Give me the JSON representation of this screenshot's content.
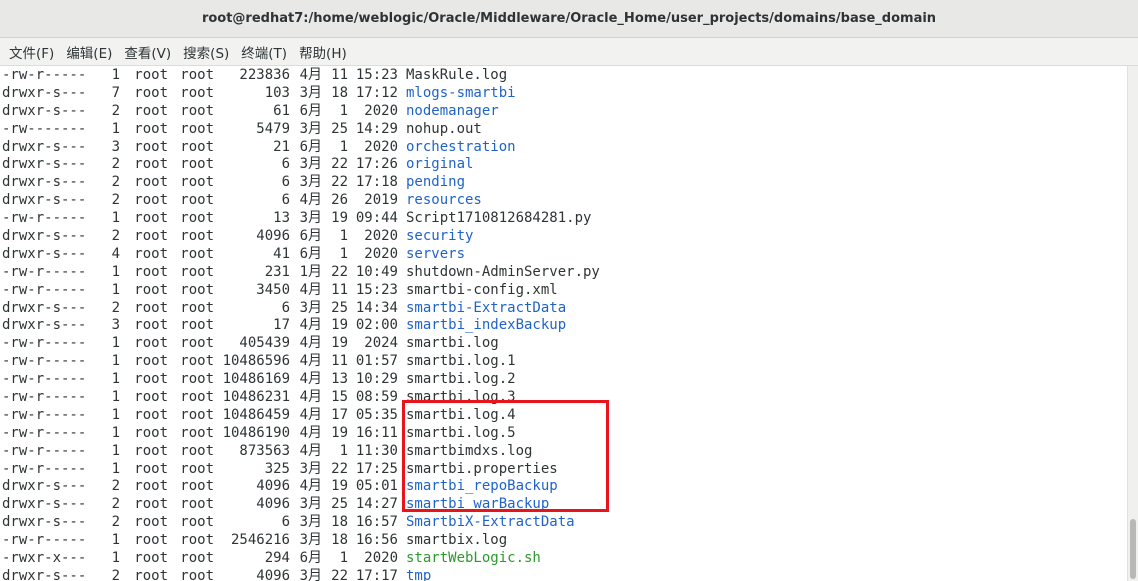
{
  "window": {
    "title": "root@redhat7:/home/weblogic/Oracle/Middleware/Oracle_Home/user_projects/domains/base_domain"
  },
  "menu": [
    "文件(F)",
    "编辑(E)",
    "查看(V)",
    "搜索(S)",
    "终端(T)",
    "帮助(H)"
  ],
  "colors": {
    "directory": "#1f63c8",
    "executable": "#2a9a2a",
    "file": "#2e3436",
    "highlight": "#e8131b"
  },
  "listing": [
    {
      "perm": "-rw-r-----",
      "links": "1",
      "owner": "root",
      "group": "root",
      "size": "223836",
      "month": "4月",
      "day": "11",
      "time": "15:23",
      "name": "MaskRule.log",
      "type": "file"
    },
    {
      "perm": "drwxr-s---",
      "links": "7",
      "owner": "root",
      "group": "root",
      "size": "103",
      "month": "3月",
      "day": "18",
      "time": "17:12",
      "name": "mlogs-smartbi",
      "type": "dir"
    },
    {
      "perm": "drwxr-s---",
      "links": "2",
      "owner": "root",
      "group": "root",
      "size": "61",
      "month": "6月",
      "day": "1",
      "time": "2020",
      "name": "nodemanager",
      "type": "dir"
    },
    {
      "perm": "-rw-------",
      "links": "1",
      "owner": "root",
      "group": "root",
      "size": "5479",
      "month": "3月",
      "day": "25",
      "time": "14:29",
      "name": "nohup.out",
      "type": "file"
    },
    {
      "perm": "drwxr-s---",
      "links": "3",
      "owner": "root",
      "group": "root",
      "size": "21",
      "month": "6月",
      "day": "1",
      "time": "2020",
      "name": "orchestration",
      "type": "dir"
    },
    {
      "perm": "drwxr-s---",
      "links": "2",
      "owner": "root",
      "group": "root",
      "size": "6",
      "month": "3月",
      "day": "22",
      "time": "17:26",
      "name": "original",
      "type": "dir"
    },
    {
      "perm": "drwxr-s---",
      "links": "2",
      "owner": "root",
      "group": "root",
      "size": "6",
      "month": "3月",
      "day": "22",
      "time": "17:18",
      "name": "pending",
      "type": "dir"
    },
    {
      "perm": "drwxr-s---",
      "links": "2",
      "owner": "root",
      "group": "root",
      "size": "6",
      "month": "4月",
      "day": "26",
      "time": "2019",
      "name": "resources",
      "type": "dir"
    },
    {
      "perm": "-rw-r-----",
      "links": "1",
      "owner": "root",
      "group": "root",
      "size": "13",
      "month": "3月",
      "day": "19",
      "time": "09:44",
      "name": "Script1710812684281.py",
      "type": "file"
    },
    {
      "perm": "drwxr-s---",
      "links": "2",
      "owner": "root",
      "group": "root",
      "size": "4096",
      "month": "6月",
      "day": "1",
      "time": "2020",
      "name": "security",
      "type": "dir"
    },
    {
      "perm": "drwxr-s---",
      "links": "4",
      "owner": "root",
      "group": "root",
      "size": "41",
      "month": "6月",
      "day": "1",
      "time": "2020",
      "name": "servers",
      "type": "dir"
    },
    {
      "perm": "-rw-r-----",
      "links": "1",
      "owner": "root",
      "group": "root",
      "size": "231",
      "month": "1月",
      "day": "22",
      "time": "10:49",
      "name": "shutdown-AdminServer.py",
      "type": "file"
    },
    {
      "perm": "-rw-r-----",
      "links": "1",
      "owner": "root",
      "group": "root",
      "size": "3450",
      "month": "4月",
      "day": "11",
      "time": "15:23",
      "name": "smartbi-config.xml",
      "type": "file"
    },
    {
      "perm": "drwxr-s---",
      "links": "2",
      "owner": "root",
      "group": "root",
      "size": "6",
      "month": "3月",
      "day": "25",
      "time": "14:34",
      "name": "smartbi-ExtractData",
      "type": "dir"
    },
    {
      "perm": "drwxr-s---",
      "links": "3",
      "owner": "root",
      "group": "root",
      "size": "17",
      "month": "4月",
      "day": "19",
      "time": "02:00",
      "name": "smartbi_indexBackup",
      "type": "dir"
    },
    {
      "perm": "-rw-r-----",
      "links": "1",
      "owner": "root",
      "group": "root",
      "size": "405439",
      "month": "4月",
      "day": "19",
      "time": "2024",
      "name": "smartbi.log",
      "type": "file"
    },
    {
      "perm": "-rw-r-----",
      "links": "1",
      "owner": "root",
      "group": "root",
      "size": "10486596",
      "month": "4月",
      "day": "11",
      "time": "01:57",
      "name": "smartbi.log.1",
      "type": "file"
    },
    {
      "perm": "-rw-r-----",
      "links": "1",
      "owner": "root",
      "group": "root",
      "size": "10486169",
      "month": "4月",
      "day": "13",
      "time": "10:29",
      "name": "smartbi.log.2",
      "type": "file"
    },
    {
      "perm": "-rw-r-----",
      "links": "1",
      "owner": "root",
      "group": "root",
      "size": "10486231",
      "month": "4月",
      "day": "15",
      "time": "08:59",
      "name": "smartbi.log.3",
      "type": "file"
    },
    {
      "perm": "-rw-r-----",
      "links": "1",
      "owner": "root",
      "group": "root",
      "size": "10486459",
      "month": "4月",
      "day": "17",
      "time": "05:35",
      "name": "smartbi.log.4",
      "type": "file"
    },
    {
      "perm": "-rw-r-----",
      "links": "1",
      "owner": "root",
      "group": "root",
      "size": "10486190",
      "month": "4月",
      "day": "19",
      "time": "16:11",
      "name": "smartbi.log.5",
      "type": "file"
    },
    {
      "perm": "-rw-r-----",
      "links": "1",
      "owner": "root",
      "group": "root",
      "size": "873563",
      "month": "4月",
      "day": "1",
      "time": "11:30",
      "name": "smartbimdxs.log",
      "type": "file"
    },
    {
      "perm": "-rw-r-----",
      "links": "1",
      "owner": "root",
      "group": "root",
      "size": "325",
      "month": "3月",
      "day": "22",
      "time": "17:25",
      "name": "smartbi.properties",
      "type": "file"
    },
    {
      "perm": "drwxr-s---",
      "links": "2",
      "owner": "root",
      "group": "root",
      "size": "4096",
      "month": "4月",
      "day": "19",
      "time": "05:01",
      "name": "smartbi_repoBackup",
      "type": "dir"
    },
    {
      "perm": "drwxr-s---",
      "links": "2",
      "owner": "root",
      "group": "root",
      "size": "4096",
      "month": "3月",
      "day": "25",
      "time": "14:27",
      "name": "smartbi_warBackup",
      "type": "dir"
    },
    {
      "perm": "drwxr-s---",
      "links": "2",
      "owner": "root",
      "group": "root",
      "size": "6",
      "month": "3月",
      "day": "18",
      "time": "16:57",
      "name": "SmartbiX-ExtractData",
      "type": "dir"
    },
    {
      "perm": "-rw-r-----",
      "links": "1",
      "owner": "root",
      "group": "root",
      "size": "2546216",
      "month": "3月",
      "day": "18",
      "time": "16:56",
      "name": "smartbix.log",
      "type": "file"
    },
    {
      "perm": "-rwxr-x---",
      "links": "1",
      "owner": "root",
      "group": "root",
      "size": "294",
      "month": "6月",
      "day": "1",
      "time": "2020",
      "name": "startWebLogic.sh",
      "type": "exec"
    },
    {
      "perm": "drwxr-s---",
      "links": "2",
      "owner": "root",
      "group": "root",
      "size": "4096",
      "month": "3月",
      "day": "22",
      "time": "17:17",
      "name": "tmp",
      "type": "dir"
    }
  ]
}
